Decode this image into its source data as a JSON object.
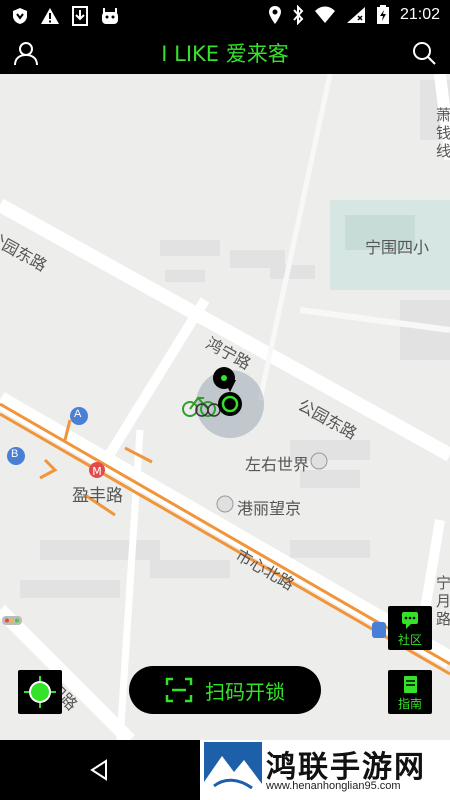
{
  "status_bar": {
    "time": "21:02"
  },
  "header": {
    "title": "I LIKE 爱来客"
  },
  "map": {
    "labels": {
      "road_gongyuan_dong_left": "公园东路",
      "road_gongyuan_dong_right": "公园东路",
      "road_hongning": "鸿宁路",
      "road_shixin_bei": "市心北路",
      "road_minhe": "民和路",
      "poi_ningwei_xiaoxue": "宁围四小",
      "poi_zuoyou_shijie": "左右世界",
      "poi_gangli_wangjing": "港丽望京",
      "metro_yingfeng": "盈丰路",
      "edge_right_top": "萧\n钱\n线",
      "edge_right_mid": "宁\n月\n路",
      "exit_a": "A",
      "exit_b": "B"
    }
  },
  "actions": {
    "scan_unlock": "扫码开锁",
    "community": "社区",
    "guide": "指南"
  },
  "watermark": {
    "title": "鸿联手游网",
    "url": "www.henanhonglian95.com"
  },
  "colors": {
    "accent": "#35e22a",
    "road_orange": "#f0953a"
  }
}
